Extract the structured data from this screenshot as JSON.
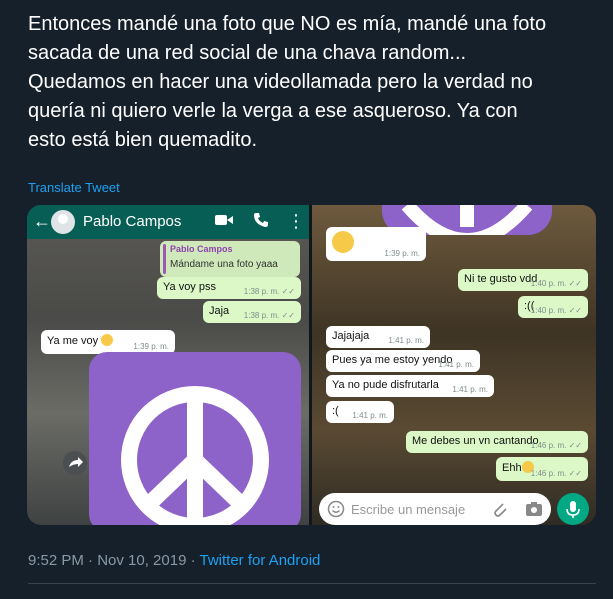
{
  "tweet": {
    "lines": [
      "Entonces mandé una foto que NO es mía, mandé una foto",
      "sacada de una red social de una chava random...",
      "Quedamos en hacer una videollamada pero la verdad no",
      "quería ni quiero verle la verga a ese asqueroso. Ya con",
      "esto está bien quemadito."
    ],
    "translate": "Translate Tweet",
    "timestamp": "9:52 PM · Nov 10, 2019",
    "separator": " · ",
    "app": "Twitter for Android"
  },
  "chat_left": {
    "contact": "Pablo Campos",
    "quote_name": "Pablo Campos",
    "quote_text": "Mándame una foto yaaa",
    "m1": "Ya voy pss",
    "t1": "1:38 p. m.",
    "m2": "Jaja",
    "t2": "1:38 p. m.",
    "m3": "Ya me voy",
    "t3": "1:39 p. m."
  },
  "chat_right": {
    "t0": "1:39 p. m.",
    "m1": "Ni te gusto vdd",
    "t1": "1:40 p. m.",
    "m2": ":((",
    "t2": "1:40 p. m.",
    "m3": "Jajajaja",
    "t3": "1:41 p. m.",
    "m4": "Pues ya me estoy yendo",
    "t4": "1:41 p. m.",
    "m5": "Ya no pude disfrutarla",
    "t5": "1:41 p. m.",
    "m6": ":(",
    "t6": "1:41 p. m.",
    "m7": "Me debes un vn cantando",
    "t7": "1:46 p. m.",
    "m8": "Ehh",
    "t8": "1:46 p. m.",
    "placeholder": "Escribe un mensaje"
  },
  "colors": {
    "whatsapp_header": "#075e54",
    "outgoing": "#dcf8c6",
    "peace_purple": "#8d62c9",
    "link": "#1da1f2"
  }
}
